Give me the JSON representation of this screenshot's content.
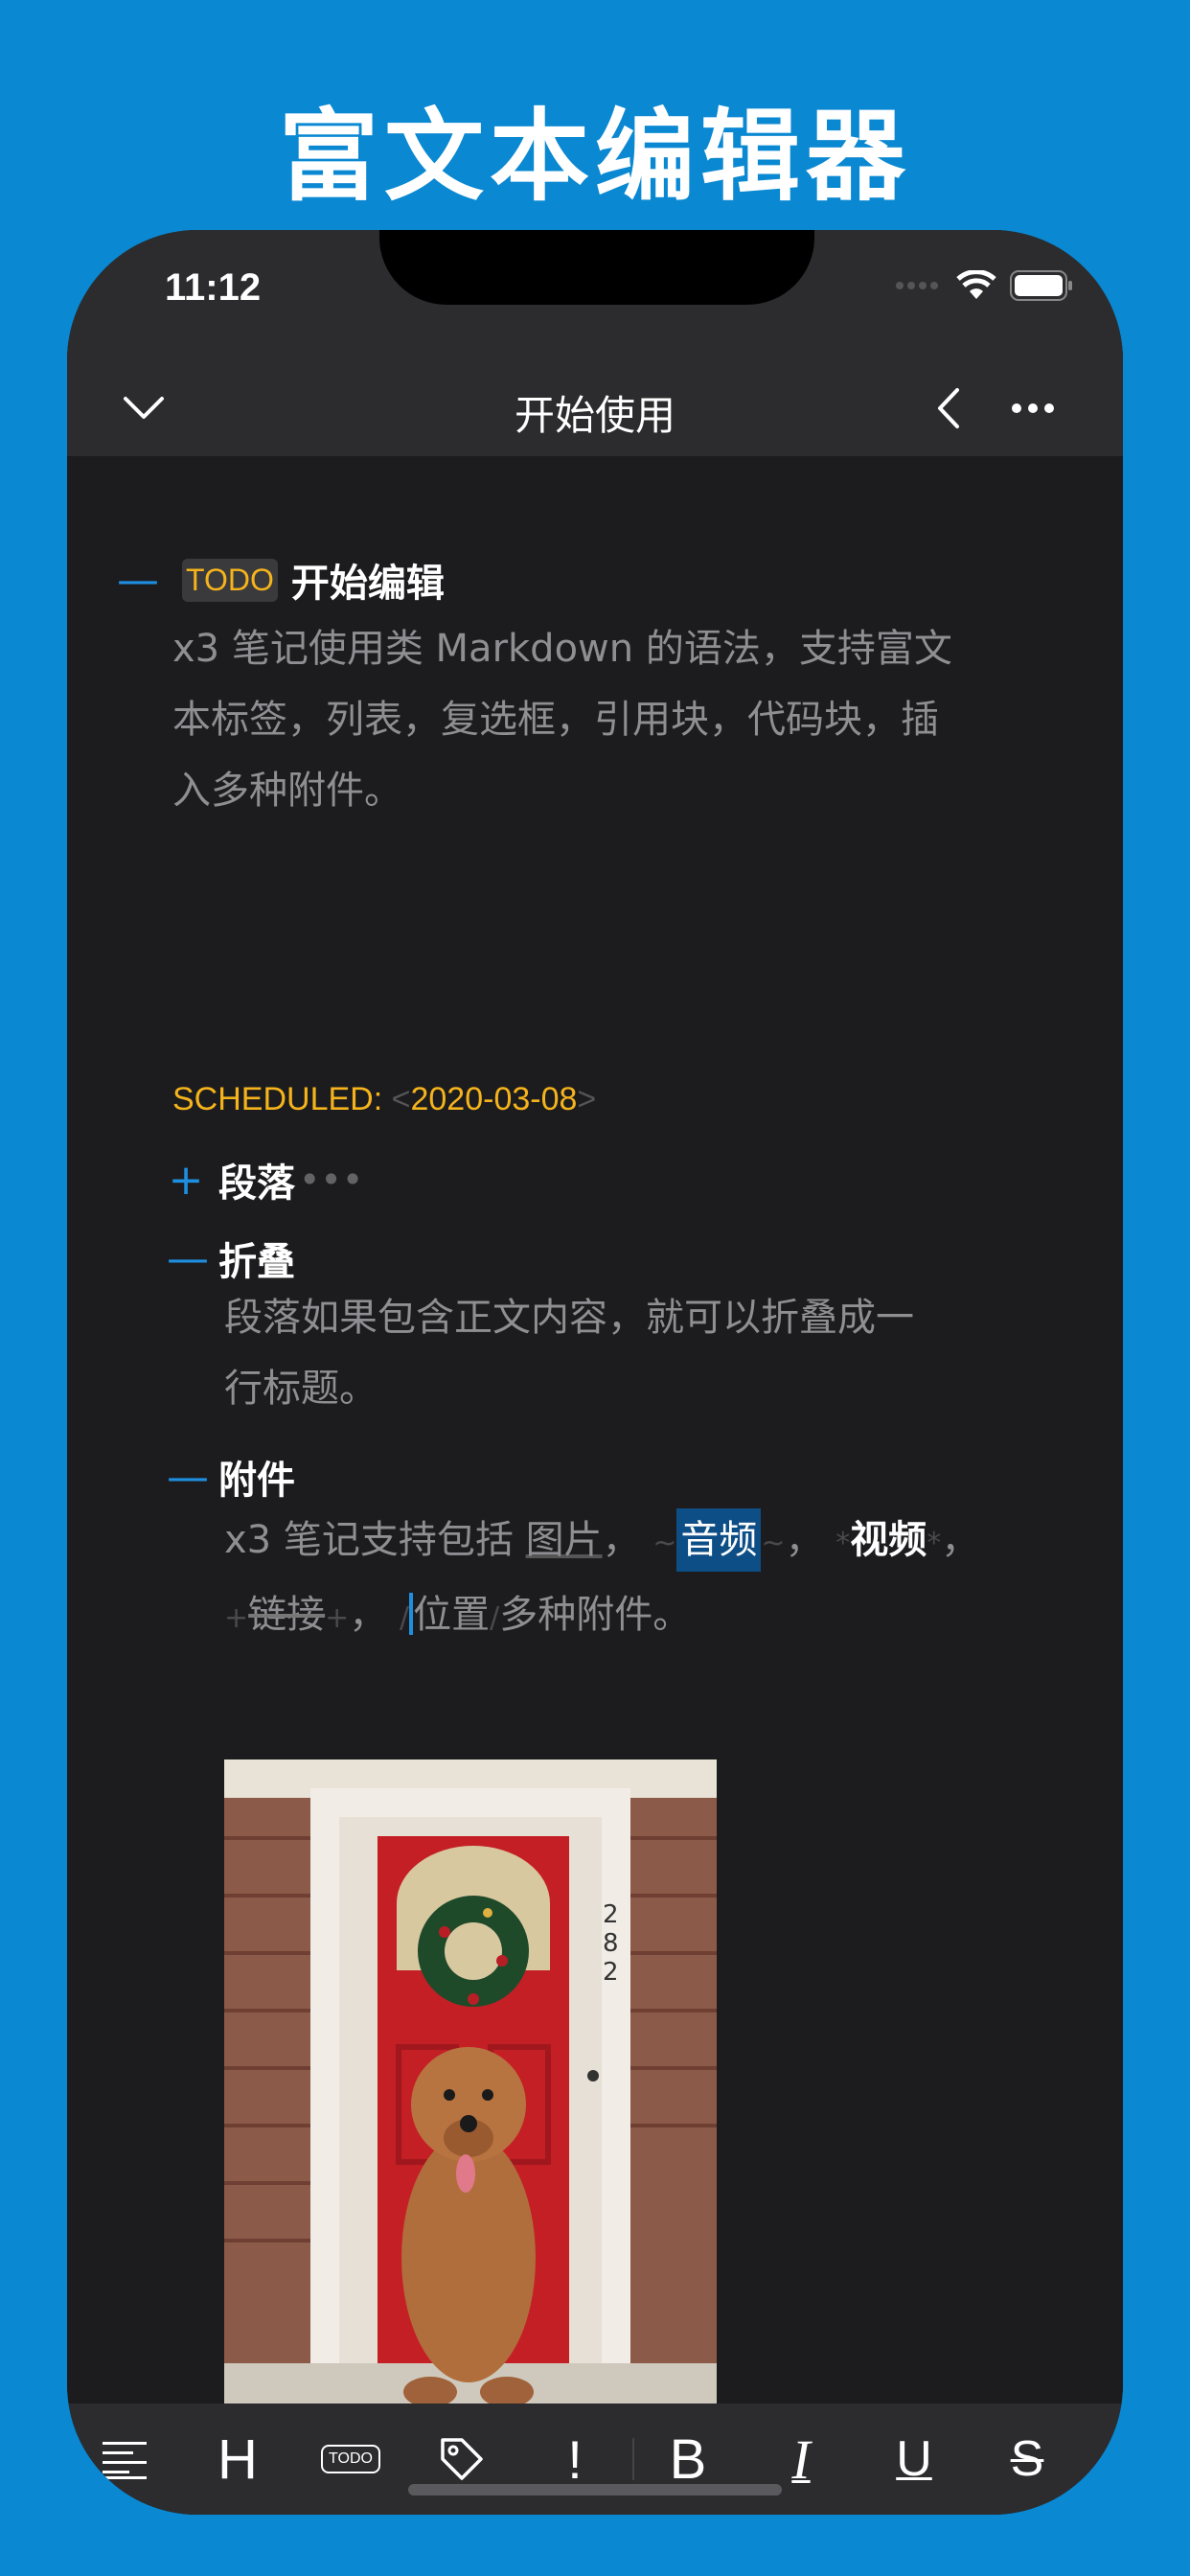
{
  "promo": {
    "title": "富文本编辑器"
  },
  "status_bar": {
    "time": "11:12"
  },
  "nav": {
    "title": "开始使用"
  },
  "outline": {
    "section1": {
      "todo_tag": "TODO",
      "heading": "开始编辑",
      "body_lines": [
        "x3 笔记使用类 Markdown 的语法，支持富文",
        "本标签，列表，复选框，引用块，代码块，插",
        "入多种附件。"
      ],
      "scheduled_label": "SCHEDULED:",
      "scheduled_open": "<",
      "scheduled_date": "2020-03-08",
      "scheduled_close": ">"
    },
    "item_paragraph": {
      "bullet": "+",
      "heading": "段落",
      "ellipsis": "•••"
    },
    "item_fold": {
      "bullet": "—",
      "heading": "折叠",
      "body_lines": [
        "段落如果包含正文内容，就可以折叠成一",
        "行标题。"
      ]
    },
    "item_attachments": {
      "bullet": "—",
      "heading": "附件",
      "line1": {
        "prefix": "x3 笔记支持包括 ",
        "image_link": "图片",
        "sep1": "，",
        "tilde_open": "~",
        "audio": "音频",
        "tilde_close": "~",
        "sep2": "，",
        "star_open": "*",
        "video": "视频",
        "star_close": "*",
        "sep3": "，"
      },
      "line2": {
        "plus_open": "+",
        "link": "链接",
        "plus_close": "+",
        "sep": "，",
        "slash_open": "/",
        "location": "位置",
        "slash_close": "/",
        "suffix": "多种附件。"
      }
    }
  },
  "toolbar": {
    "items": [
      {
        "icon": "align-left-icon"
      },
      {
        "icon": "heading-icon",
        "label": "H"
      },
      {
        "icon": "todo-icon",
        "label": "TODO"
      },
      {
        "icon": "tag-icon"
      },
      {
        "icon": "priority-icon",
        "label": "!"
      },
      {
        "icon": "bold-icon",
        "label": "B"
      },
      {
        "icon": "italic-icon",
        "label": "I"
      },
      {
        "icon": "underline-icon",
        "label": "U"
      },
      {
        "icon": "strikethrough-icon",
        "label": "S"
      }
    ]
  },
  "colors": {
    "background": "#0A88D2",
    "surface": "#1C1C1E",
    "bar": "#2C2C2E",
    "accent": "#1E8FE0",
    "todo": "#F5B31C",
    "highlight": "#0E4E86"
  }
}
